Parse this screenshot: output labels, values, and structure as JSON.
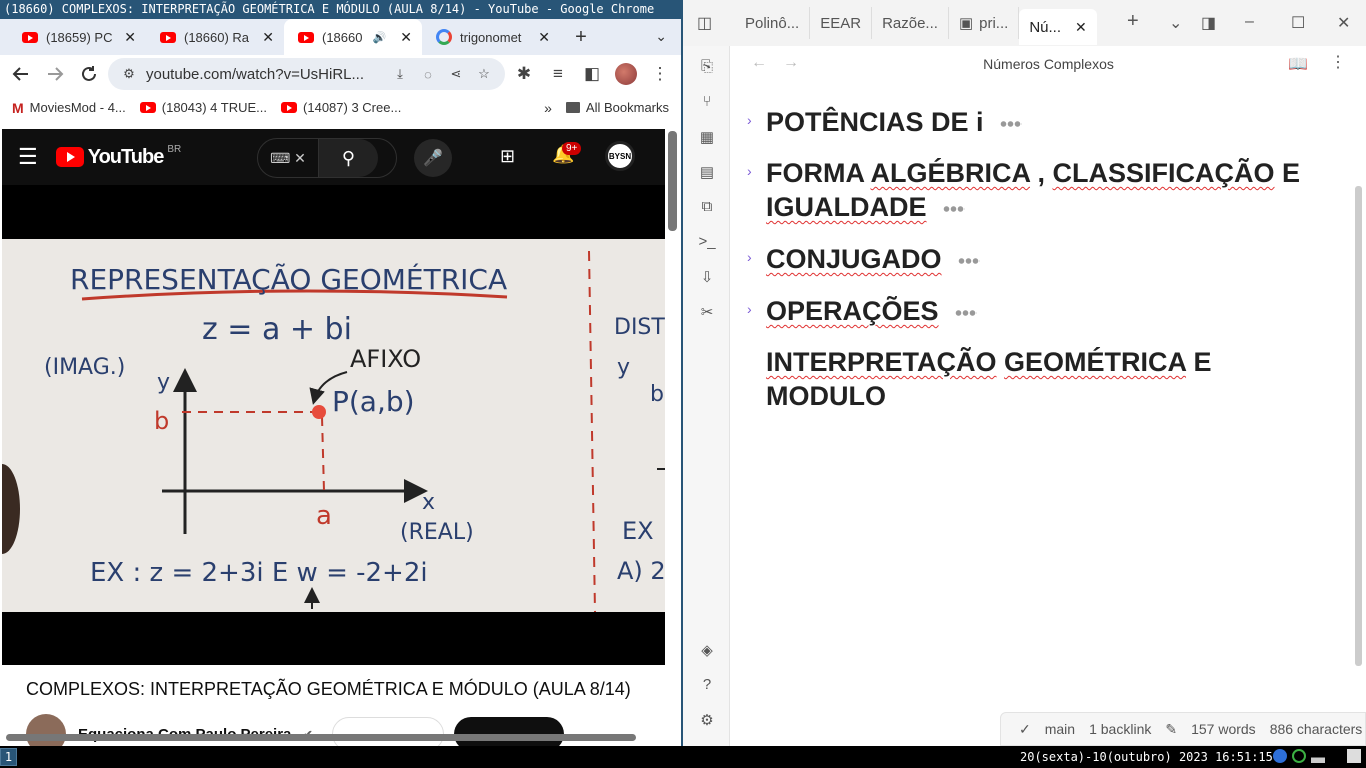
{
  "chrome": {
    "title": "(18660) COMPLEXOS: INTERPRETAÇÃO GEOMÉTRICA E MÓDULO (AULA 8/14) - YouTube - Google Chrome",
    "tabs": [
      {
        "label": "(18659) PC",
        "icon": "youtube-icon"
      },
      {
        "label": "(18660) Ra",
        "icon": "youtube-icon"
      },
      {
        "label": "(18660",
        "icon": "youtube-icon",
        "active": true,
        "audio": "🔊"
      },
      {
        "label": "trigonomet",
        "icon": "google-icon"
      }
    ],
    "close_glyph": "✕",
    "new_tab_glyph": "+",
    "tab_menu_glyph": "⌄",
    "url": "youtube.com/watch?v=UsHiRL...",
    "bookmarks": [
      {
        "label": "MoviesMod - 4..."
      },
      {
        "label": "(18043) 4 TRUE..."
      },
      {
        "label": "(14087) 3 Cree..."
      }
    ],
    "bookmarks_more": "»",
    "all_bookmarks": "All Bookmarks"
  },
  "youtube": {
    "logo": "YouTube",
    "region": "BR",
    "notif_count": "9+",
    "avatar_text": "BYSN",
    "video_title": "COMPLEXOS: INTERPRETAÇÃO GEOMÉTRICA E MÓDULO (AULA 8/14)",
    "channel": "Equaciona Com Paulo Pereira",
    "verified": "✔",
    "board": {
      "heading": "REPRESENTAÇÃO GEOMÉTRICA",
      "formula": "z = a + bi",
      "imag": "(IMAG.)",
      "afixo": "AFIXO",
      "point": "P(a,b)",
      "y": "y",
      "b": "b",
      "a": "a",
      "x": "x",
      "real": "(REAL)",
      "example": "EX :  z = 2+3i  E  w = -2+2i",
      "side1": "DIST",
      "side2": "y",
      "side3": "b",
      "side4": "EX",
      "side5": "A) 2"
    }
  },
  "obsidian": {
    "tabs": [
      {
        "label": "Polinô..."
      },
      {
        "label": "EEAR"
      },
      {
        "label": "Razõe..."
      },
      {
        "label": "pri..."
      },
      {
        "label": "Nú...",
        "active": true
      }
    ],
    "note_title": "Números Complexos",
    "headings": [
      {
        "text_a": "POTÊNCIAS DE i",
        "collapsed": true
      },
      {
        "text_a": "FORMA ",
        "squig1": "ALGÉBRICA",
        "text_b": " , ",
        "squig2": "CLASSIFICAÇÃO",
        "text_c": " E ",
        "squig3": "IGUALDADE",
        "collapsed": true
      },
      {
        "squig1": "CONJUGADO",
        "collapsed": true
      },
      {
        "squig1": "OPERAÇÕES",
        "collapsed": true
      },
      {
        "squig1": "INTERPRETAÇÃO",
        "squig2": "GEOMÉTRICA",
        "text_a": " E",
        "line2": "MODULO"
      }
    ],
    "status": {
      "branch": "main",
      "backlinks": "1 backlink",
      "words": "157 words",
      "chars": "886 characters"
    }
  },
  "taskbar": {
    "workspace": "1",
    "clock": "20(sexta)-10(outubro) 2023 16:51:15"
  }
}
